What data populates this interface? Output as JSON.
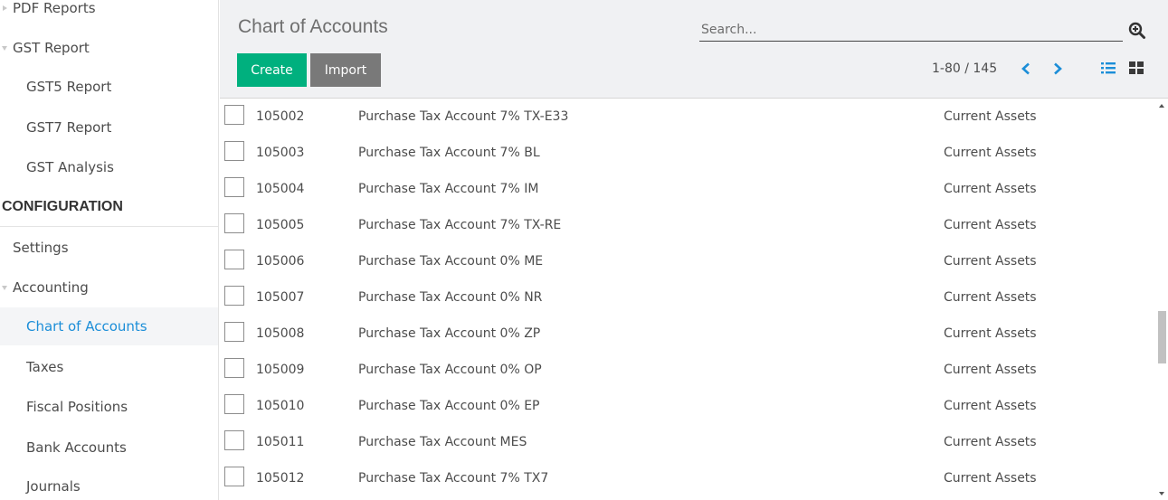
{
  "sidebar": {
    "items": [
      {
        "label": "PDF Reports",
        "level": 1,
        "caret": "closed"
      },
      {
        "label": "GST Report",
        "level": 1,
        "caret": "open"
      },
      {
        "label": "GST5 Report",
        "level": 2
      },
      {
        "label": "GST7 Report",
        "level": 2
      },
      {
        "label": "GST Analysis",
        "level": 2
      }
    ],
    "section_header": "CONFIGURATION",
    "config_items": [
      {
        "label": "Settings",
        "level": 1
      },
      {
        "label": "Accounting",
        "level": 1,
        "caret": "open"
      },
      {
        "label": "Chart of Accounts",
        "level": 2,
        "active": true
      },
      {
        "label": "Taxes",
        "level": 2
      },
      {
        "label": "Fiscal Positions",
        "level": 2
      },
      {
        "label": "Bank Accounts",
        "level": 2
      },
      {
        "label": "Journals",
        "level": 2
      }
    ]
  },
  "control_panel": {
    "title": "Chart of Accounts",
    "search": {
      "placeholder": "Search...",
      "value": ""
    },
    "search_icon": "search-plus-icon",
    "buttons": {
      "create": "Create",
      "import": "Import"
    },
    "pager": "1-80 / 145",
    "prev_icon": "chevron-left-icon",
    "next_icon": "chevron-right-icon",
    "views": [
      "list-view-icon",
      "kanban-view-icon"
    ]
  },
  "accounts": [
    {
      "code": "105002",
      "name": "Purchase Tax Account 7% TX-E33",
      "type": "Current Assets"
    },
    {
      "code": "105003",
      "name": "Purchase Tax Account 7% BL",
      "type": "Current Assets"
    },
    {
      "code": "105004",
      "name": "Purchase Tax Account 7% IM",
      "type": "Current Assets"
    },
    {
      "code": "105005",
      "name": "Purchase Tax Account 7% TX-RE",
      "type": "Current Assets"
    },
    {
      "code": "105006",
      "name": "Purchase Tax Account 0% ME",
      "type": "Current Assets"
    },
    {
      "code": "105007",
      "name": "Purchase Tax Account 0% NR",
      "type": "Current Assets"
    },
    {
      "code": "105008",
      "name": "Purchase Tax Account 0% ZP",
      "type": "Current Assets"
    },
    {
      "code": "105009",
      "name": "Purchase Tax Account 0% OP",
      "type": "Current Assets"
    },
    {
      "code": "105010",
      "name": "Purchase Tax Account 0% EP",
      "type": "Current Assets"
    },
    {
      "code": "105011",
      "name": "Purchase Tax Account MES",
      "type": "Current Assets"
    },
    {
      "code": "105012",
      "name": "Purchase Tax Account 7% TX7",
      "type": "Current Assets"
    }
  ],
  "colors": {
    "create_button": "#00b07e",
    "import_button": "#797979",
    "active_link": "#1c8ed8",
    "pager_arrows": "#1c8ed8",
    "control_panel_bg": "#f0f1f3"
  }
}
